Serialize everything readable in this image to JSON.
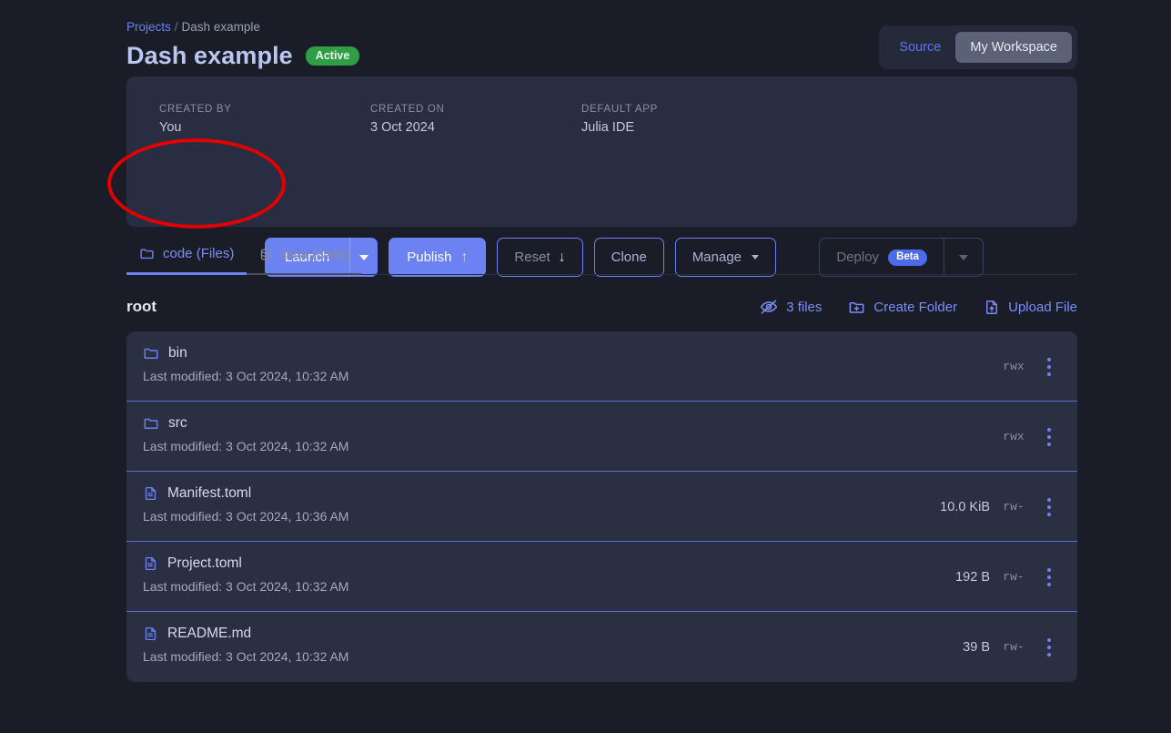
{
  "breadcrumb": {
    "parent": "Projects",
    "separator": "/",
    "current": "Dash example"
  },
  "header": {
    "title": "Dash example",
    "status": "Active"
  },
  "workspace_toggle": {
    "source_label": "Source",
    "workspace_label": "My Workspace",
    "selected": "My Workspace"
  },
  "meta": [
    {
      "label": "CREATED BY",
      "value": "You"
    },
    {
      "label": "CREATED ON",
      "value": "3 Oct 2024"
    },
    {
      "label": "DEFAULT APP",
      "value": "Julia IDE"
    }
  ],
  "actions": {
    "launch": "Launch",
    "publish": "Publish",
    "publish_glyph": "↑",
    "reset": "Reset",
    "reset_glyph": "↓",
    "clone": "Clone",
    "manage": "Manage",
    "deploy": "Deploy",
    "deploy_badge": "Beta"
  },
  "tabs": [
    {
      "label": "code (Files)",
      "icon": "folder-icon",
      "active": true
    },
    {
      "label": "data (Data)",
      "icon": "database-icon",
      "active": false
    }
  ],
  "file_toolbar": {
    "directory": "root",
    "hidden_files": "3 files",
    "create_folder": "Create Folder",
    "upload_file": "Upload File"
  },
  "files": [
    {
      "name": "bin",
      "type": "folder",
      "modified": "Last modified: 3 Oct 2024, 10:32 AM",
      "size": "",
      "perms": "rwx"
    },
    {
      "name": "src",
      "type": "folder",
      "modified": "Last modified: 3 Oct 2024, 10:32 AM",
      "size": "",
      "perms": "rwx"
    },
    {
      "name": "Manifest.toml",
      "type": "file",
      "modified": "Last modified: 3 Oct 2024, 10:36 AM",
      "size": "10.0 KiB",
      "perms": "rw-"
    },
    {
      "name": "Project.toml",
      "type": "file",
      "modified": "Last modified: 3 Oct 2024, 10:32 AM",
      "size": "192 B",
      "perms": "rw-"
    },
    {
      "name": "README.md",
      "type": "file",
      "modified": "Last modified: 3 Oct 2024, 10:32 AM",
      "size": "39 B",
      "perms": "rw-"
    }
  ],
  "annotation": {
    "shape": "ellipse",
    "color": "#e00000",
    "targets": "launch-button"
  },
  "colors": {
    "page_background": "#1a1d27",
    "card_background": "#282d41",
    "row_background": "#2a2f42",
    "accent_blue": "#6c82f2",
    "status_green": "#2f9e44",
    "separator_blue": "#5b6dd6",
    "annotation_red": "#e00000"
  }
}
